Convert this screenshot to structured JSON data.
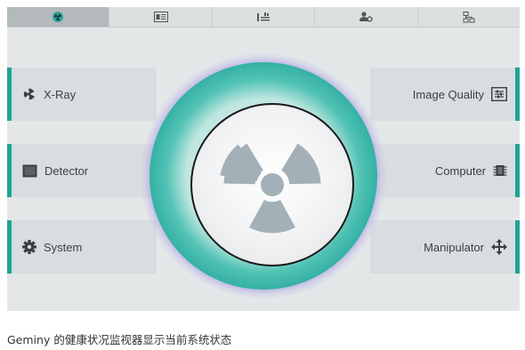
{
  "tabs": [
    {
      "icon": "radiation-icon",
      "active": true
    },
    {
      "icon": "image-list-icon",
      "active": false
    },
    {
      "icon": "equalizer-icon",
      "active": false
    },
    {
      "icon": "user-settings-icon",
      "active": false
    },
    {
      "icon": "network-icon",
      "active": false
    }
  ],
  "panels": {
    "xray": {
      "label": "X-Ray",
      "icon": "xray-radiation-icon"
    },
    "detector": {
      "label": "Detector",
      "icon": "detector-monitor-icon"
    },
    "system": {
      "label": "System",
      "icon": "gear-icon"
    },
    "image_quality": {
      "label": "Image Quality",
      "icon": "image-quality-icon"
    },
    "computer": {
      "label": "Computer",
      "icon": "cpu-chip-icon"
    },
    "manipulator": {
      "label": "Manipulator",
      "icon": "move-arrows-icon"
    }
  },
  "dial": {
    "icon": "radiation-symbol-icon"
  },
  "colors": {
    "accent": "#1ea395",
    "panel_bg": "#d9dddf",
    "screen_bg": "#e4e7e8"
  },
  "caption": "Geminy 的健康状况监视器显示当前系统状态"
}
